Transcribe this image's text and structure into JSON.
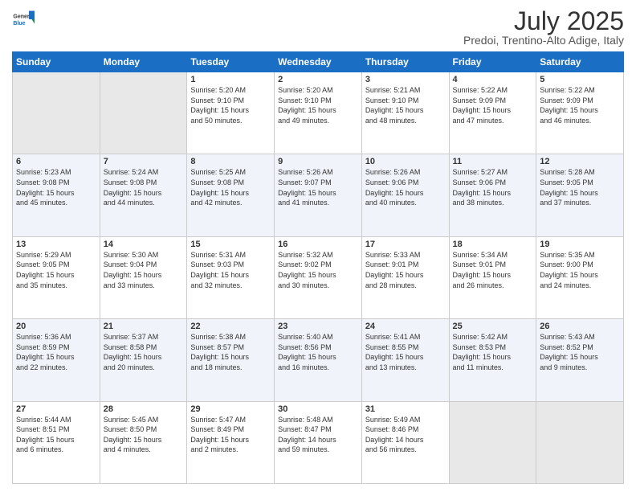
{
  "header": {
    "logo_line1": "General",
    "logo_line2": "Blue",
    "month": "July 2025",
    "location": "Predoi, Trentino-Alto Adige, Italy"
  },
  "weekdays": [
    "Sunday",
    "Monday",
    "Tuesday",
    "Wednesday",
    "Thursday",
    "Friday",
    "Saturday"
  ],
  "weeks": [
    [
      {
        "day": "",
        "info": ""
      },
      {
        "day": "",
        "info": ""
      },
      {
        "day": "1",
        "info": "Sunrise: 5:20 AM\nSunset: 9:10 PM\nDaylight: 15 hours\nand 50 minutes."
      },
      {
        "day": "2",
        "info": "Sunrise: 5:20 AM\nSunset: 9:10 PM\nDaylight: 15 hours\nand 49 minutes."
      },
      {
        "day": "3",
        "info": "Sunrise: 5:21 AM\nSunset: 9:10 PM\nDaylight: 15 hours\nand 48 minutes."
      },
      {
        "day": "4",
        "info": "Sunrise: 5:22 AM\nSunset: 9:09 PM\nDaylight: 15 hours\nand 47 minutes."
      },
      {
        "day": "5",
        "info": "Sunrise: 5:22 AM\nSunset: 9:09 PM\nDaylight: 15 hours\nand 46 minutes."
      }
    ],
    [
      {
        "day": "6",
        "info": "Sunrise: 5:23 AM\nSunset: 9:08 PM\nDaylight: 15 hours\nand 45 minutes."
      },
      {
        "day": "7",
        "info": "Sunrise: 5:24 AM\nSunset: 9:08 PM\nDaylight: 15 hours\nand 44 minutes."
      },
      {
        "day": "8",
        "info": "Sunrise: 5:25 AM\nSunset: 9:08 PM\nDaylight: 15 hours\nand 42 minutes."
      },
      {
        "day": "9",
        "info": "Sunrise: 5:26 AM\nSunset: 9:07 PM\nDaylight: 15 hours\nand 41 minutes."
      },
      {
        "day": "10",
        "info": "Sunrise: 5:26 AM\nSunset: 9:06 PM\nDaylight: 15 hours\nand 40 minutes."
      },
      {
        "day": "11",
        "info": "Sunrise: 5:27 AM\nSunset: 9:06 PM\nDaylight: 15 hours\nand 38 minutes."
      },
      {
        "day": "12",
        "info": "Sunrise: 5:28 AM\nSunset: 9:05 PM\nDaylight: 15 hours\nand 37 minutes."
      }
    ],
    [
      {
        "day": "13",
        "info": "Sunrise: 5:29 AM\nSunset: 9:05 PM\nDaylight: 15 hours\nand 35 minutes."
      },
      {
        "day": "14",
        "info": "Sunrise: 5:30 AM\nSunset: 9:04 PM\nDaylight: 15 hours\nand 33 minutes."
      },
      {
        "day": "15",
        "info": "Sunrise: 5:31 AM\nSunset: 9:03 PM\nDaylight: 15 hours\nand 32 minutes."
      },
      {
        "day": "16",
        "info": "Sunrise: 5:32 AM\nSunset: 9:02 PM\nDaylight: 15 hours\nand 30 minutes."
      },
      {
        "day": "17",
        "info": "Sunrise: 5:33 AM\nSunset: 9:01 PM\nDaylight: 15 hours\nand 28 minutes."
      },
      {
        "day": "18",
        "info": "Sunrise: 5:34 AM\nSunset: 9:01 PM\nDaylight: 15 hours\nand 26 minutes."
      },
      {
        "day": "19",
        "info": "Sunrise: 5:35 AM\nSunset: 9:00 PM\nDaylight: 15 hours\nand 24 minutes."
      }
    ],
    [
      {
        "day": "20",
        "info": "Sunrise: 5:36 AM\nSunset: 8:59 PM\nDaylight: 15 hours\nand 22 minutes."
      },
      {
        "day": "21",
        "info": "Sunrise: 5:37 AM\nSunset: 8:58 PM\nDaylight: 15 hours\nand 20 minutes."
      },
      {
        "day": "22",
        "info": "Sunrise: 5:38 AM\nSunset: 8:57 PM\nDaylight: 15 hours\nand 18 minutes."
      },
      {
        "day": "23",
        "info": "Sunrise: 5:40 AM\nSunset: 8:56 PM\nDaylight: 15 hours\nand 16 minutes."
      },
      {
        "day": "24",
        "info": "Sunrise: 5:41 AM\nSunset: 8:55 PM\nDaylight: 15 hours\nand 13 minutes."
      },
      {
        "day": "25",
        "info": "Sunrise: 5:42 AM\nSunset: 8:53 PM\nDaylight: 15 hours\nand 11 minutes."
      },
      {
        "day": "26",
        "info": "Sunrise: 5:43 AM\nSunset: 8:52 PM\nDaylight: 15 hours\nand 9 minutes."
      }
    ],
    [
      {
        "day": "27",
        "info": "Sunrise: 5:44 AM\nSunset: 8:51 PM\nDaylight: 15 hours\nand 6 minutes."
      },
      {
        "day": "28",
        "info": "Sunrise: 5:45 AM\nSunset: 8:50 PM\nDaylight: 15 hours\nand 4 minutes."
      },
      {
        "day": "29",
        "info": "Sunrise: 5:47 AM\nSunset: 8:49 PM\nDaylight: 15 hours\nand 2 minutes."
      },
      {
        "day": "30",
        "info": "Sunrise: 5:48 AM\nSunset: 8:47 PM\nDaylight: 14 hours\nand 59 minutes."
      },
      {
        "day": "31",
        "info": "Sunrise: 5:49 AM\nSunset: 8:46 PM\nDaylight: 14 hours\nand 56 minutes."
      },
      {
        "day": "",
        "info": ""
      },
      {
        "day": "",
        "info": ""
      }
    ]
  ]
}
